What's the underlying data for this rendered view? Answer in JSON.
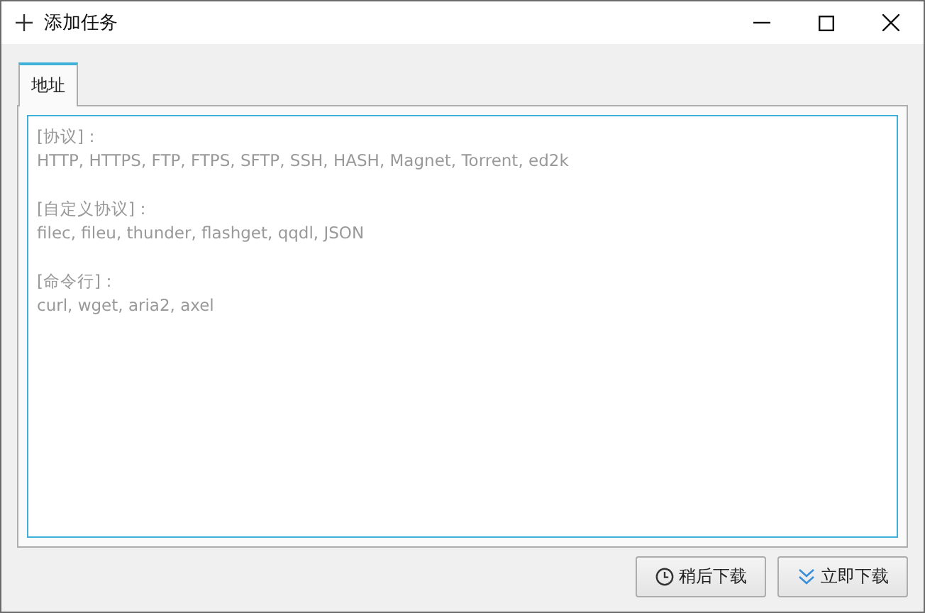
{
  "window": {
    "title": "添加任务"
  },
  "tabs": [
    {
      "label": "地址",
      "selected": true
    }
  ],
  "url_input": {
    "placeholder": "[协议]：\nHTTP, HTTPS, FTP, FTPS, SFTP, SSH, HASH, Magnet, Torrent, ed2k\n\n[自定义协议]：\nfilec, fileu, thunder, flashget, qqdl, JSON\n\n[命令行]：\ncurl, wget, aria2, axel"
  },
  "buttons": [
    {
      "label": "稍后下载",
      "kind": "later"
    },
    {
      "label": "立即下载",
      "kind": "now"
    }
  ]
}
